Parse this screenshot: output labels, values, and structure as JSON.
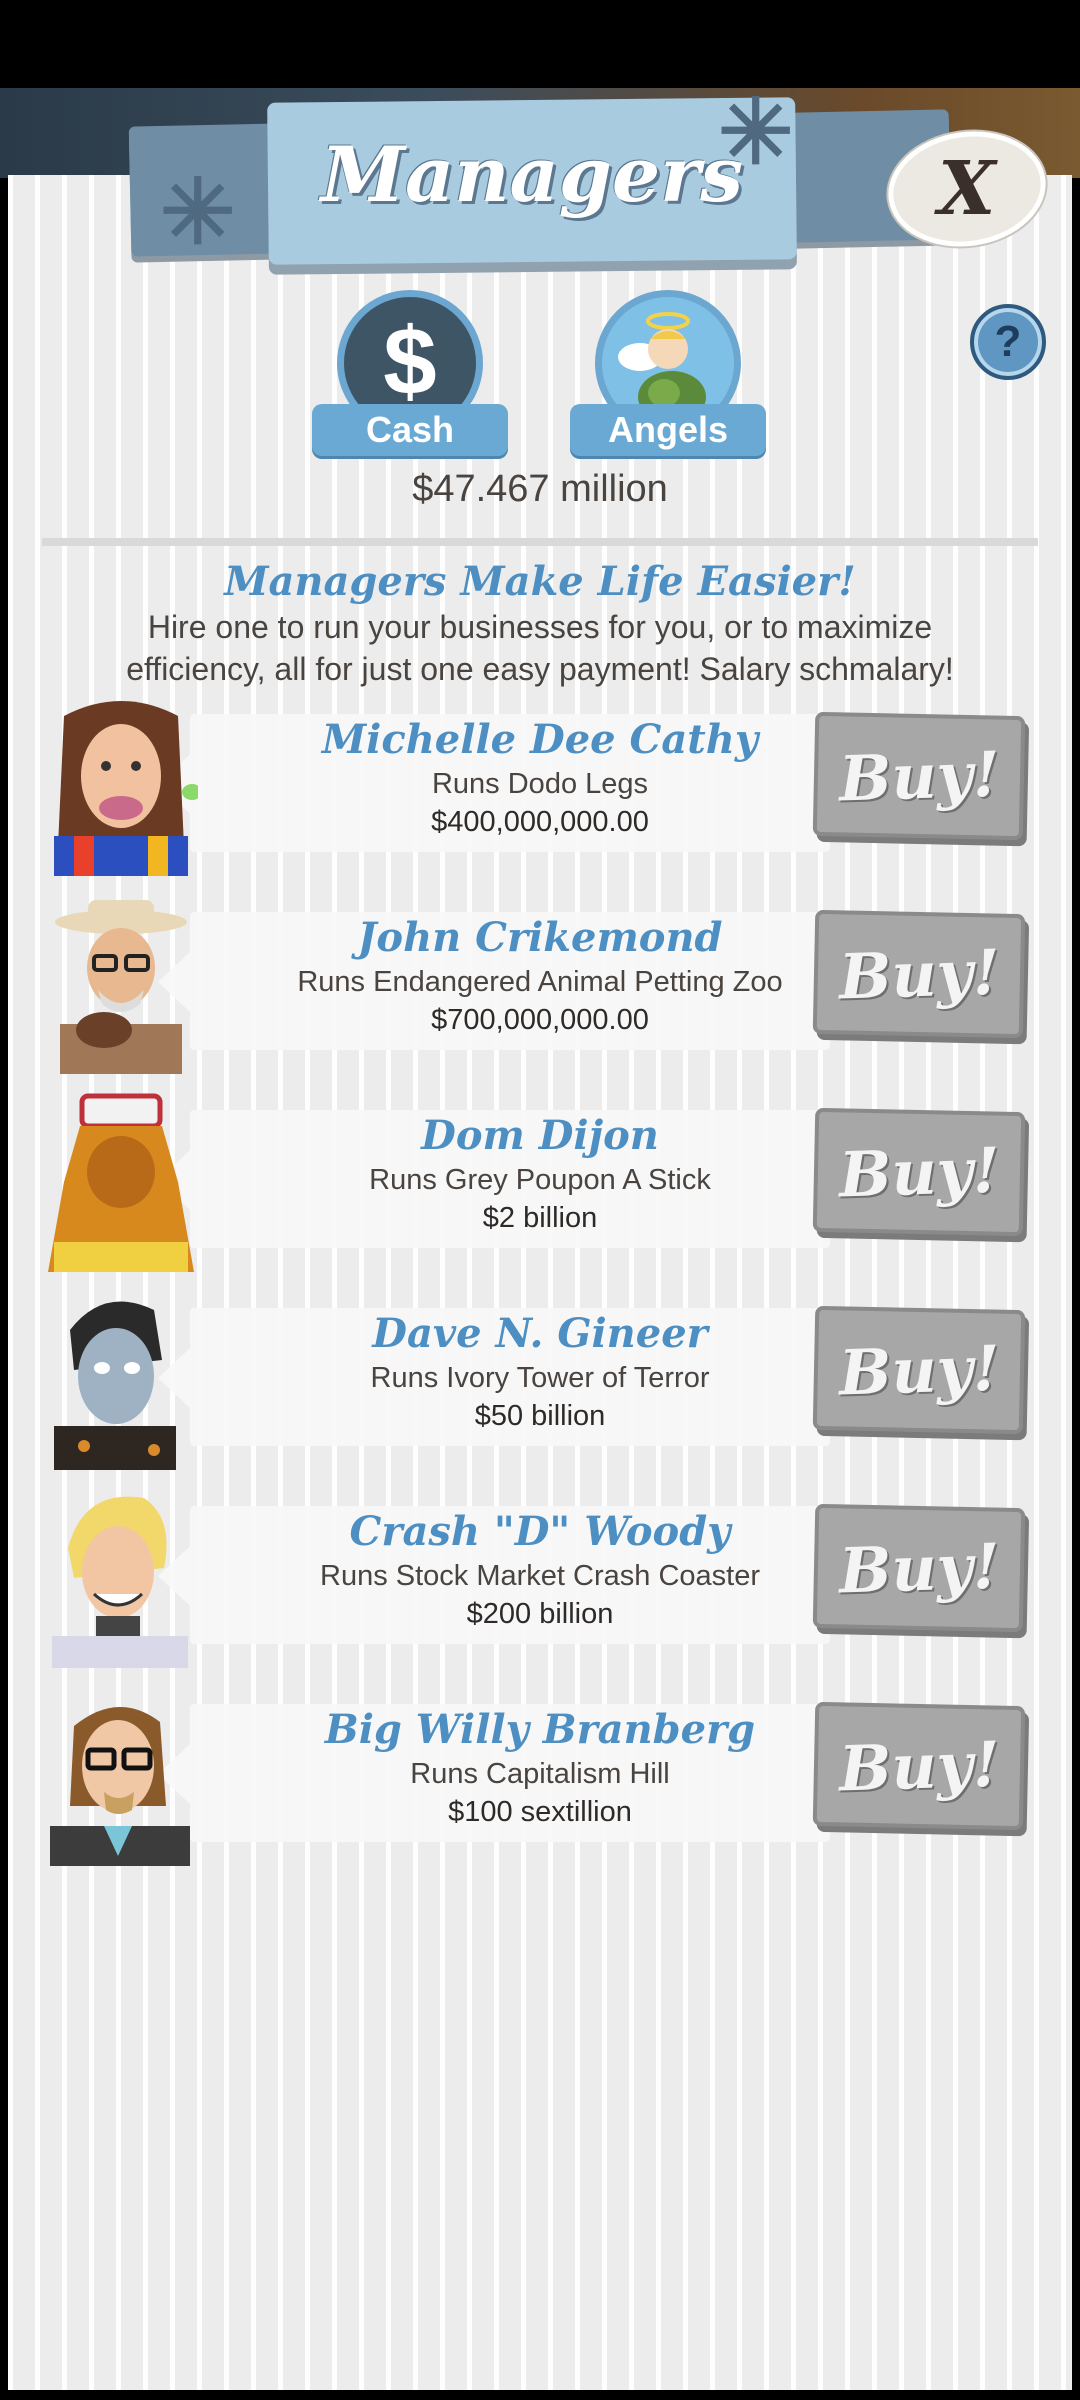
{
  "header": {
    "title": "Managers",
    "close_label": "X",
    "help_label": "?"
  },
  "currency": {
    "cash_label": "Cash",
    "cash_symbol": "$",
    "angels_label": "Angels",
    "selected": "Cash",
    "amount": "$47.467 million"
  },
  "intro": {
    "headline": "Managers Make Life Easier!",
    "description": "Hire one to run your businesses for you, or to maximize efficiency, all for just one easy payment! Salary schmalary!"
  },
  "managers": [
    {
      "name": "Michelle Dee Cathy",
      "runs": "Runs Dodo Legs",
      "cost": "$400,000,000.00",
      "buy_label": "Buy!"
    },
    {
      "name": "John Crikemond",
      "runs": "Runs Endangered Animal Petting Zoo",
      "cost": "$700,000,000.00",
      "buy_label": "Buy!"
    },
    {
      "name": "Dom Dijon",
      "runs": "Runs Grey Poupon A Stick",
      "cost": "$2 billion",
      "buy_label": "Buy!"
    },
    {
      "name": "Dave N. Gineer",
      "runs": "Runs Ivory Tower of Terror",
      "cost": "$50 billion",
      "buy_label": "Buy!"
    },
    {
      "name": "Crash \"D\" Woody",
      "runs": "Runs Stock Market Crash Coaster",
      "cost": "$200 billion",
      "buy_label": "Buy!"
    },
    {
      "name": "Big Willy Branberg",
      "runs": "Runs Capitalism Hill",
      "cost": "$100 sextillion",
      "buy_label": "Buy!"
    }
  ],
  "colors": {
    "accent_blue": "#4d8fc2",
    "tab_blue": "#6aa9d4",
    "buy_gray": "#a7a7a7"
  },
  "icons": [
    "snowflake-star-icon",
    "close-icon",
    "help-icon",
    "dollar-icon",
    "angel-icon",
    "manager-avatar"
  ]
}
